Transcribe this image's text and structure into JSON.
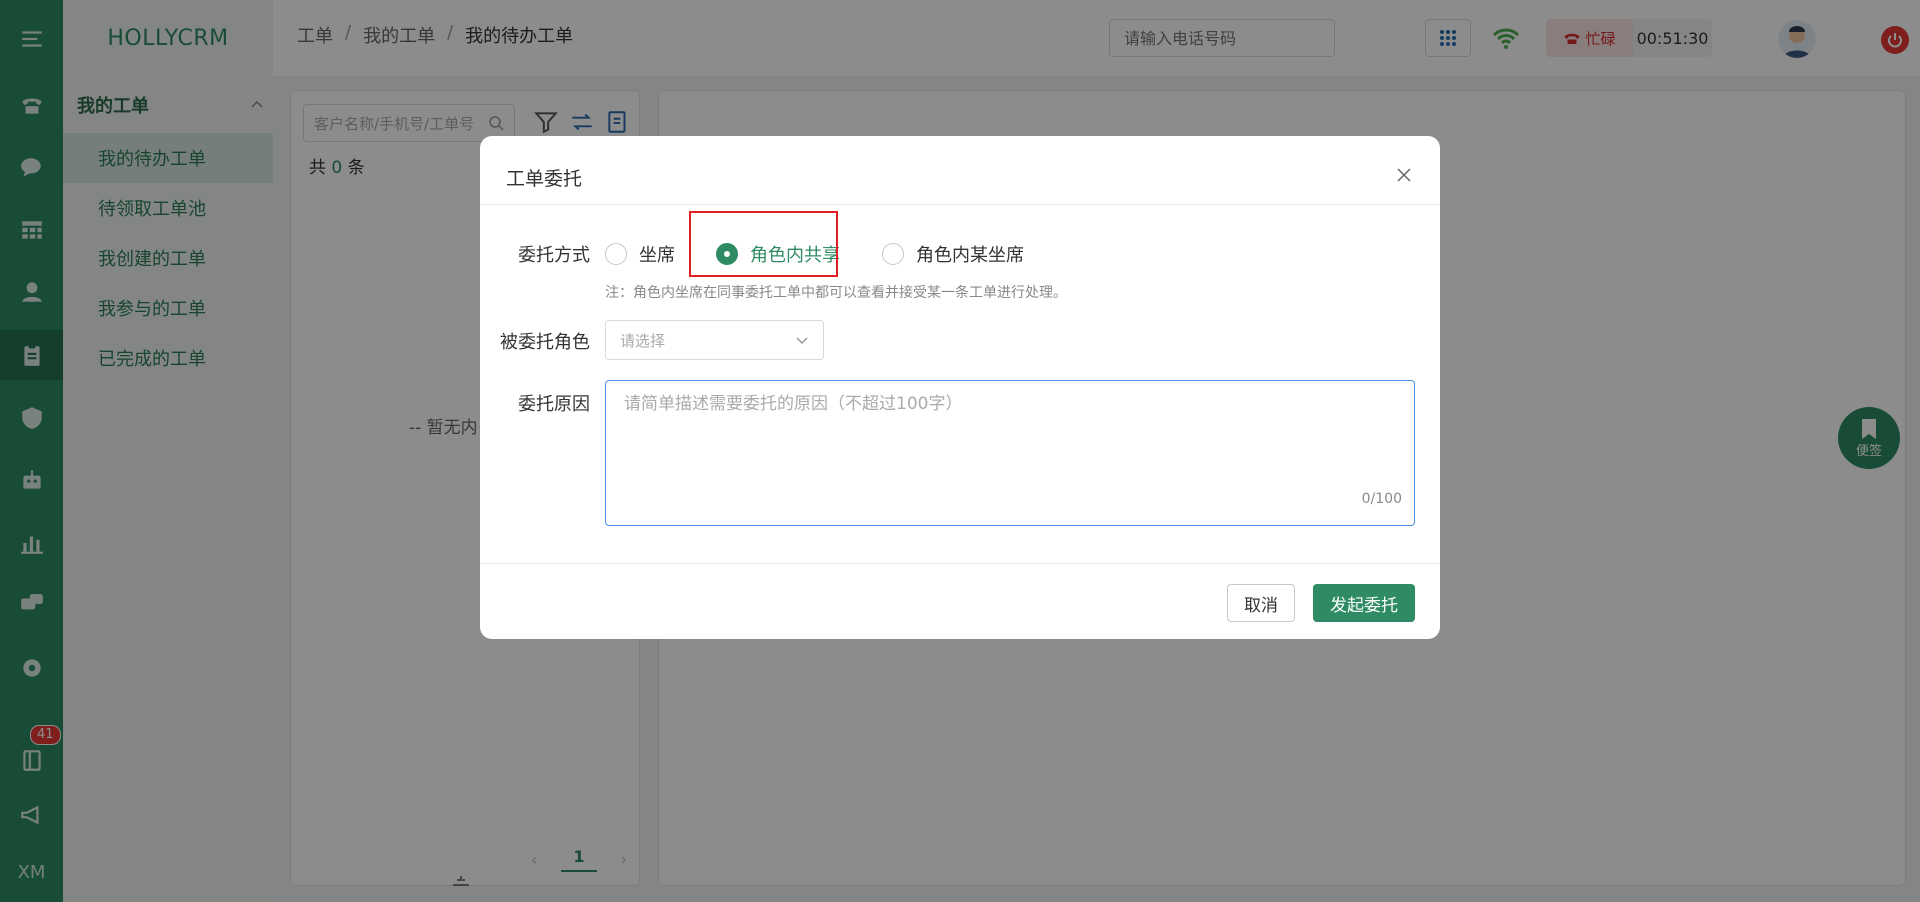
{
  "app": {
    "brand": "HOLLYCRM"
  },
  "rail": {
    "items": [
      {
        "icon": "menu-icon"
      },
      {
        "icon": "phone-icon"
      },
      {
        "icon": "chat-icon"
      },
      {
        "icon": "table-icon"
      },
      {
        "icon": "user-icon"
      },
      {
        "icon": "clipboard-icon"
      },
      {
        "icon": "shield-icon"
      },
      {
        "icon": "robot-icon"
      },
      {
        "icon": "bar-chart-icon"
      },
      {
        "icon": "message-icon"
      },
      {
        "icon": "gear-icon"
      },
      {
        "icon": "notebook-icon"
      },
      {
        "icon": "megaphone-icon"
      }
    ],
    "badge": "41",
    "bottom_text": "XM"
  },
  "sidebar": {
    "group_title": "我的工单",
    "items": [
      {
        "label": "我的待办工单"
      },
      {
        "label": "待领取工单池"
      },
      {
        "label": "我创建的工单"
      },
      {
        "label": "我参与的工单"
      },
      {
        "label": "已完成的工单"
      }
    ]
  },
  "header": {
    "breadcrumb": [
      "工单",
      "我的工单",
      "我的待办工单"
    ],
    "separator": "/",
    "phone_placeholder": "请输入电话号码",
    "status": "忙碌",
    "timer": "00:51:30"
  },
  "list_panel": {
    "search_placeholder": "客户名称/手机号/工单号",
    "count_prefix": "共",
    "count_value": "0",
    "count_suffix": "条",
    "empty_text": "-- 暂无内",
    "page": "1"
  },
  "note_button": {
    "label": "便签"
  },
  "dialog": {
    "title": "工单委托",
    "mode_label": "委托方式",
    "modes": [
      {
        "label": "坐席",
        "checked": false
      },
      {
        "label": "角色内共享",
        "checked": true
      },
      {
        "label": "角色内某坐席",
        "checked": false
      }
    ],
    "note": "注：角色内坐席在同事委托工单中都可以查看并接受某一条工单进行处理。",
    "role_label": "被委托角色",
    "role_placeholder": "请选择",
    "reason_label": "委托原因",
    "reason_placeholder": "请简单描述需要委托的原因（不超过100字）",
    "counter": "0/100",
    "cancel_label": "取消",
    "submit_label": "发起委托"
  },
  "colors": {
    "accent": "#2e8b63",
    "highlight": "#e02020",
    "danger": "#e53935"
  }
}
